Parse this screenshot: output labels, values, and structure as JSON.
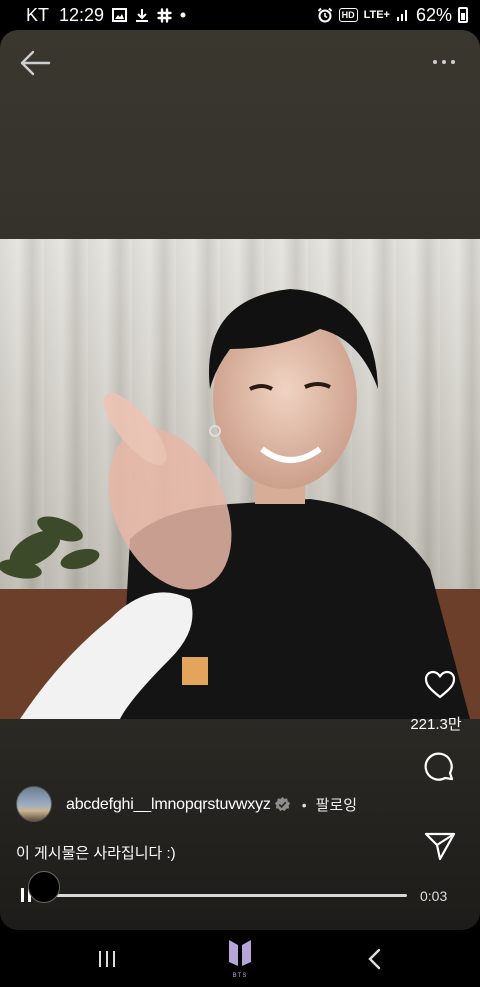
{
  "status_bar": {
    "carrier": "KT",
    "time": "12:29",
    "hd_badge": "HD",
    "network": "LTE+",
    "battery": "62%",
    "icons": [
      "gallery-icon",
      "download-icon",
      "slack-icon",
      "dot-icon",
      "alarm-icon",
      "hd-icon",
      "lte-icon",
      "signal-icon",
      "battery-icon"
    ]
  },
  "header": {
    "back_icon": "arrow-left-icon",
    "more_icon": "more-horizontal-icon"
  },
  "actions": {
    "like_icon": "heart-icon",
    "like_count": "221.3만",
    "comment_icon": "comment-icon",
    "share_icon": "send-icon"
  },
  "post": {
    "username": "abcdefghi__lmnopqrstuvwxyz",
    "verified_icon": "verified-badge-icon",
    "separator": "•",
    "follow_label": "팔로잉",
    "caption": "이 게시물은 사라집니다 :)"
  },
  "player": {
    "play_icon": "pause-icon",
    "progress": 0.0,
    "time": "0:03"
  },
  "nav": {
    "recents_icon": "recents-icon",
    "home_icon": "bts-logo-icon",
    "home_label": "BTS",
    "back_icon": "chevron-left-icon"
  },
  "colors": {
    "background": "#000000",
    "card_top": "#3a372f",
    "card_bottom": "#1d1c19",
    "nav_logo": "#b8a4d9"
  }
}
